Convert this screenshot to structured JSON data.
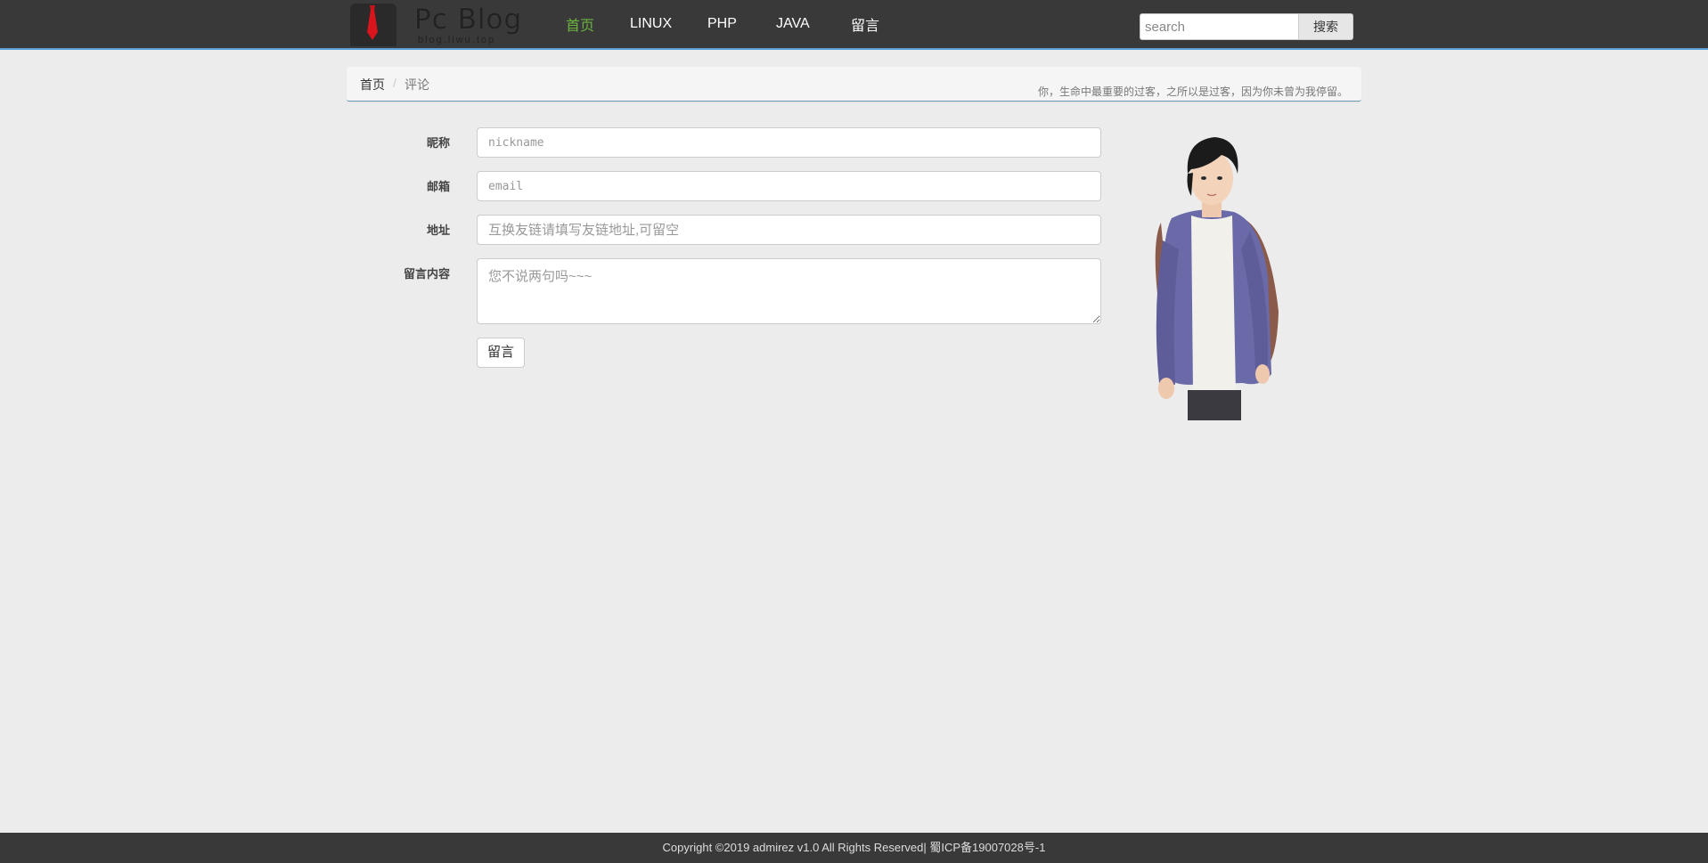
{
  "header": {
    "logo_title": "Pc Blog",
    "logo_subtitle": "blog.liwu.top",
    "nav": [
      {
        "label": "首页",
        "active": true
      },
      {
        "label": "LINUX",
        "active": false
      },
      {
        "label": "PHP",
        "active": false
      },
      {
        "label": "JAVA",
        "active": false
      },
      {
        "label": "留言",
        "active": false
      }
    ],
    "search_placeholder": "search",
    "search_button": "搜索"
  },
  "breadcrumb": {
    "home": "首页",
    "separator": "/",
    "current": "评论",
    "quote": "你，生命中最重要的过客，之所以是过客，因为你未曾为我停留。"
  },
  "form": {
    "nickname_label": "昵称",
    "nickname_placeholder": "nickname",
    "email_label": "邮箱",
    "email_placeholder": "email",
    "address_label": "地址",
    "address_placeholder": "互换友链请填写友链地址,可留空",
    "content_label": "留言内容",
    "content_placeholder": "您不说两句吗~~~",
    "submit_label": "留言"
  },
  "footer": {
    "copyright": "Copyright ©2019 admirez v1.0 All Rights Reserved| 蜀ICP备19007028号-1"
  },
  "colors": {
    "header_bg": "#393939",
    "nav_active": "#6cb33e",
    "accent_line": "#5aa0d8",
    "page_bg": "#ececec"
  }
}
